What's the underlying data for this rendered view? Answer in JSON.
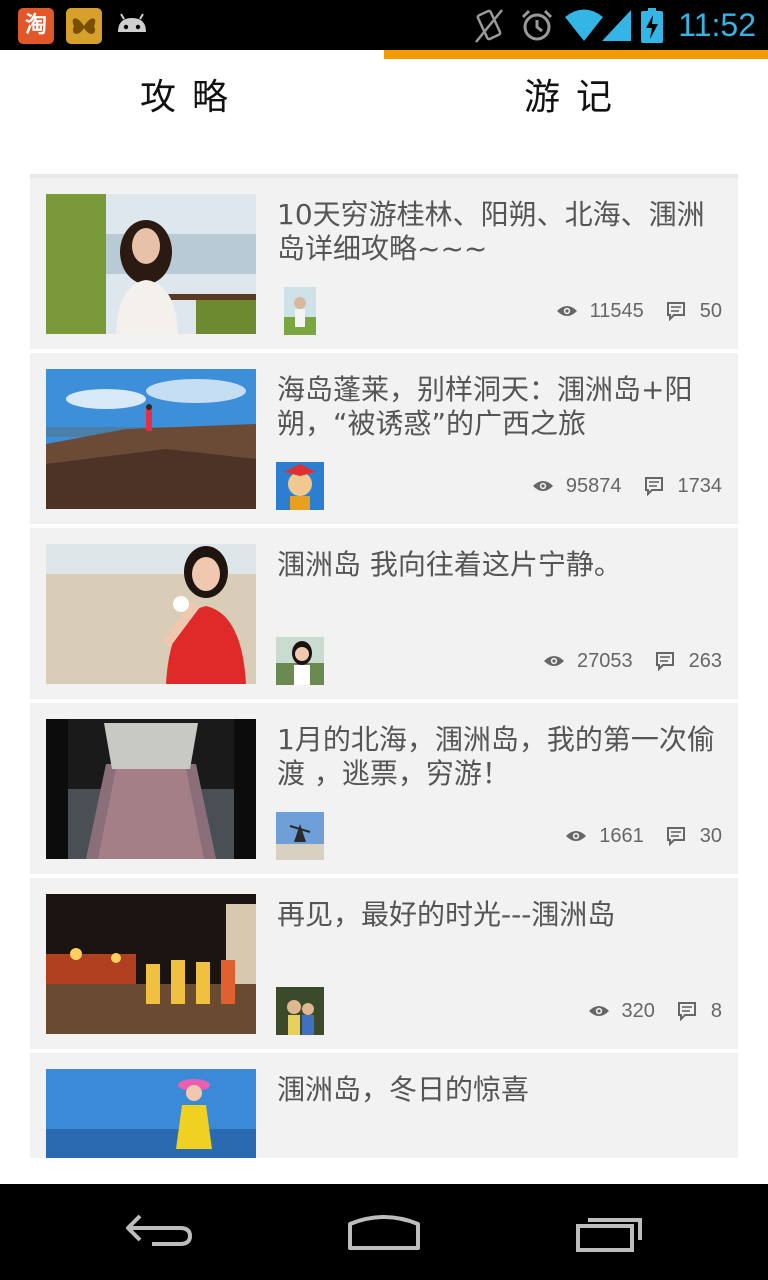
{
  "status_bar": {
    "time": "11:52",
    "taobao_glyph": "淘",
    "icons": [
      "taobao-app-icon",
      "butterfly-app-icon",
      "android-icon",
      "vibrate-icon",
      "alarm-icon",
      "wifi-icon",
      "signal-icon",
      "battery-charging-icon"
    ],
    "time_color": "#33b5e5"
  },
  "tabs": [
    {
      "label": "攻略",
      "selected": false
    },
    {
      "label": "游记",
      "selected": true
    }
  ],
  "accent_color": "#f29b00",
  "posts": [
    {
      "title": "10天穷游桂林、阳朔、北海、涠洲岛详细攻略~~~",
      "views": "11545",
      "comments": "50"
    },
    {
      "title": "海岛蓬莱，别样洞天：涠洲岛+阳朔，“被诱惑”的广西之旅",
      "views": "95874",
      "comments": "1734"
    },
    {
      "title": "涠洲岛 我向往着这片宁静。",
      "views": "27053",
      "comments": "263"
    },
    {
      "title": "1月的北海，涠洲岛，我的第一次偷渡 ，逃票，穷游！",
      "views": "1661",
      "comments": "30"
    },
    {
      "title": "再见，最好的时光---涠洲岛",
      "views": "320",
      "comments": "8"
    },
    {
      "title": "涠洲岛，冬日的惊喜",
      "views": "",
      "comments": ""
    }
  ],
  "nav_bar": {
    "icons": [
      "back-icon",
      "home-icon",
      "recent-apps-icon"
    ]
  }
}
